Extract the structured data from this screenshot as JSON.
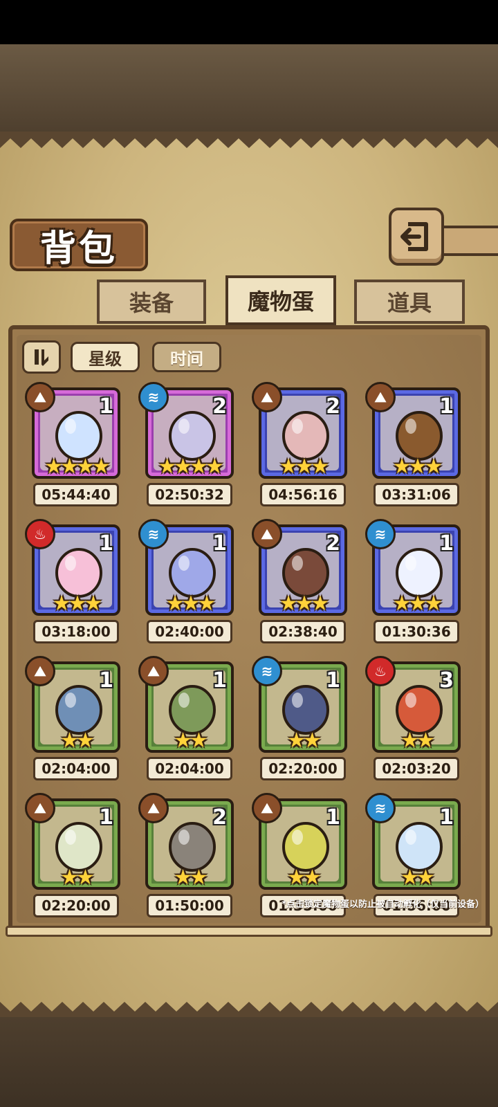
{
  "header": {
    "title": "背包"
  },
  "tabs": [
    {
      "label": "装备",
      "active": false
    },
    {
      "label": "魔物蛋",
      "active": true
    },
    {
      "label": "道具",
      "active": false
    }
  ],
  "sort": {
    "star_label": "星级",
    "time_label": "时间",
    "selected": "星级"
  },
  "colors": {
    "pink_rarity": "#9b3fae",
    "blue_rarity": "#3b43b0",
    "green_rarity": "#57803a",
    "star": "#ffd23a"
  },
  "eggs": [
    {
      "element": "earth",
      "count": "1",
      "stars": 4,
      "time": "05:44:40",
      "rarity": "pink",
      "egg_color": "#cfe3ff"
    },
    {
      "element": "water",
      "count": "2",
      "stars": 4,
      "time": "02:50:32",
      "rarity": "pink",
      "egg_color": "#c9c4e6"
    },
    {
      "element": "earth",
      "count": "2",
      "stars": 3,
      "time": "04:56:16",
      "rarity": "blue",
      "egg_color": "#e4b8b8"
    },
    {
      "element": "earth",
      "count": "1",
      "stars": 3,
      "time": "03:31:06",
      "rarity": "blue",
      "egg_color": "#8a5a2e"
    },
    {
      "element": "fire",
      "count": "1",
      "stars": 3,
      "time": "03:18:00",
      "rarity": "blue",
      "egg_color": "#f7c0d8"
    },
    {
      "element": "water",
      "count": "1",
      "stars": 3,
      "time": "02:40:00",
      "rarity": "blue",
      "egg_color": "#9fa8e8"
    },
    {
      "element": "earth",
      "count": "2",
      "stars": 3,
      "time": "02:38:40",
      "rarity": "blue",
      "egg_color": "#7a4a3a"
    },
    {
      "element": "water",
      "count": "1",
      "stars": 3,
      "time": "01:30:36",
      "rarity": "blue",
      "egg_color": "#eef2ff"
    },
    {
      "element": "earth",
      "count": "1",
      "stars": 2,
      "time": "02:04:00",
      "rarity": "green",
      "egg_color": "#6f8fb6"
    },
    {
      "element": "earth",
      "count": "1",
      "stars": 2,
      "time": "02:04:00",
      "rarity": "green",
      "egg_color": "#7e9a5a"
    },
    {
      "element": "water",
      "count": "1",
      "stars": 2,
      "time": "02:20:00",
      "rarity": "green",
      "egg_color": "#4f5a88"
    },
    {
      "element": "fire",
      "count": "3",
      "stars": 2,
      "time": "02:03:20",
      "rarity": "green",
      "egg_color": "#d65a3a"
    },
    {
      "element": "earth",
      "count": "1",
      "stars": 2,
      "time": "02:20:00",
      "rarity": "green",
      "egg_color": "#dfe6c8"
    },
    {
      "element": "earth",
      "count": "2",
      "stars": 2,
      "time": "01:50:00",
      "rarity": "green",
      "egg_color": "#8a837a"
    },
    {
      "element": "earth",
      "count": "1",
      "stars": 2,
      "time": "01:35:00",
      "rarity": "green",
      "egg_color": "#d7d25a"
    },
    {
      "element": "water",
      "count": "1",
      "stars": 2,
      "time": "01:56:00",
      "rarity": "green",
      "egg_color": "#cfe4f8"
    }
  ],
  "hint": "*点击锁定魔物蛋以防止被自动孵化（仅当前设备）"
}
